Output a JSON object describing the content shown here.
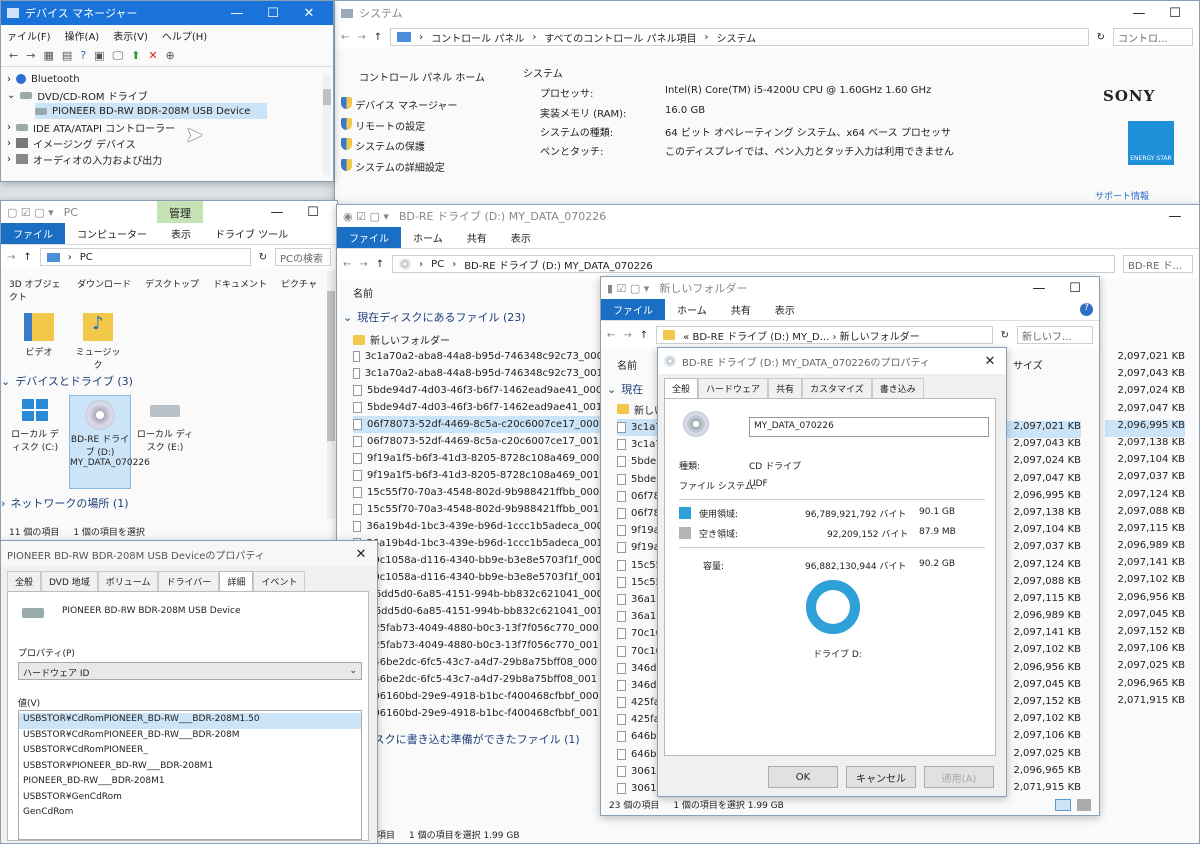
{
  "device_manager": {
    "title": "デバイス マネージャー",
    "menu": [
      "ァイル(F)",
      "操作(A)",
      "表示(V)",
      "ヘルプ(H)"
    ],
    "tree": [
      {
        "label": "Bluetooth",
        "level": 0
      },
      {
        "label": "DVD/CD-ROM ドライブ",
        "level": 0
      },
      {
        "label": "PIONEER BD-RW   BDR-208M USB Device",
        "level": 1
      },
      {
        "label": "IDE ATA/ATAPI コントローラー",
        "level": 0
      },
      {
        "label": "イメージング デバイス",
        "level": 0
      },
      {
        "label": "オーディオの入力および出力",
        "level": 0
      }
    ]
  },
  "system": {
    "title": "システム",
    "breadcrumb": [
      "コントロール パネル",
      "すべてのコントロール パネル項目",
      "システム"
    ],
    "search_placeholder": "コントロ...",
    "home_link": "コントロール パネル ホーム",
    "side_links": [
      "デバイス マネージャー",
      "リモートの設定",
      "システムの保護",
      "システムの詳細設定"
    ],
    "section": "システム",
    "rows": [
      {
        "label": "プロセッサ:",
        "value": "Intel(R) Core(TM) i5-4200U CPU @ 1.60GHz   1.60 GHz"
      },
      {
        "label": "実装メモリ (RAM):",
        "value": "16.0 GB"
      },
      {
        "label": "システムの種類:",
        "value": "64 ビット オペレーティング システム、x64 ベース プロセッサ"
      },
      {
        "label": "ペンとタッチ:",
        "value": "このディスプレイでは、ペン入力とタッチ入力は利用できません"
      }
    ],
    "brand": "SONY",
    "energy_star": "ENERGY STAR",
    "support": "サポート情報"
  },
  "pc_window": {
    "title": "PC",
    "manage_tab": "管理",
    "ribbon": [
      "ファイル",
      "コンピューター",
      "表示",
      "ドライブ ツール"
    ],
    "address": "PC",
    "search": "PCの検索",
    "quick": [
      "3D オブジェクト",
      "ダウンロード",
      "デスクトップ",
      "ドキュメント",
      "ピクチャ"
    ],
    "folders": [
      "ビデオ",
      "ミュージック"
    ],
    "devices_header": "デバイスとドライブ (3)",
    "drives": [
      "ローカル ディスク (C:)",
      "BD-RE ドライブ (D:) MY_DATA_070226",
      "ローカル ディスク (E:)"
    ],
    "network_header": "ネットワークの場所 (1)",
    "status": [
      "11 個の項目",
      "1 個の項目を選択"
    ]
  },
  "bdre_window": {
    "title": "BD-RE ドライブ (D:) MY_DATA_070226",
    "ribbon": [
      "ファイル",
      "ホーム",
      "共有",
      "表示"
    ],
    "address": [
      "PC",
      "BD-RE ドライブ (D:) MY_DATA_070226"
    ],
    "search": "BD-RE ド...",
    "col_name": "名前",
    "group_current": "現在ディスクにあるファイル (23)",
    "files": [
      "新しいフォルダー",
      "3c1a70a2-aba8-44a8-b95d-746348c92c73_000",
      "3c1a70a2-aba8-44a8-b95d-746348c92c73_001",
      "5bde94d7-4d03-46f3-b6f7-1462ead9ae41_000",
      "5bde94d7-4d03-46f3-b6f7-1462ead9ae41_001",
      "06f78073-52df-4469-8c5a-c20c6007ce17_000",
      "06f78073-52df-4469-8c5a-c20c6007ce17_001",
      "9f19a1f5-b6f3-41d3-8205-8728c108a469_000",
      "9f19a1f5-b6f3-41d3-8205-8728c108a469_001",
      "15c55f70-70a3-4548-802d-9b988421ffbb_000",
      "15c55f70-70a3-4548-802d-9b988421ffbb_001",
      "36a19b4d-1bc3-439e-b96d-1ccc1b5adeca_000",
      "36a19b4d-1bc3-439e-b96d-1ccc1b5adeca_001",
      "70c1058a-d116-4340-bb9e-b3e8e5703f1f_000",
      "70c1058a-d116-4340-bb9e-b3e8e5703f1f_001",
      "346dd5d0-6a85-4151-994b-bb832c621041_000",
      "346dd5d0-6a85-4151-994b-bb832c621041_001",
      "425fab73-4049-4880-b0c3-13f7f056c770_000",
      "425fab73-4049-4880-b0c3-13f7f056c770_001",
      "646be2dc-6fc5-43c7-a4d7-29b8a75bff08_000",
      "646be2dc-6fc5-43c7-a4d7-29b8a75bff08_001",
      "306160bd-29e9-4918-b1bc-f400468cfbbf_000",
      "306160bd-29e9-4918-b1bc-f400468cfbbf_001"
    ],
    "group_pending": "ディスクに書き込む準備ができたファイル (1)",
    "sizes_right": [
      "2,097,021 KB",
      "2,097,043 KB",
      "2,097,024 KB",
      "2,097,047 KB",
      "2,096,995 KB",
      "2,097,138 KB",
      "2,097,104 KB",
      "2,097,037 KB",
      "2,097,124 KB",
      "2,097,088 KB",
      "2,097,115 KB",
      "2,096,989 KB",
      "2,097,141 KB",
      "2,097,102 KB",
      "2,096,956 KB",
      "2,097,045 KB",
      "2,097,152 KB",
      "2,097,106 KB",
      "2,097,025 KB",
      "2,096,965 KB",
      "2,071,915 KB"
    ],
    "status": [
      "項目",
      "1 個の項目を選択  1.99 GB"
    ]
  },
  "new_folder_window": {
    "title": "新しいフォルダー",
    "ribbon": [
      "ファイル",
      "ホーム",
      "共有",
      "表示"
    ],
    "address": "« BD-RE ドライブ (D:) MY_D...  ›  新しいフォルダー",
    "search": "新しいフ...",
    "col_name": "名前",
    "col_size": "サイズ",
    "group_current": "現在",
    "first_item": "新しい",
    "items": [
      "3c1a7",
      "3c1a7",
      "5bde",
      "5bde",
      "06f78",
      "06f78",
      "9f19a",
      "9f19a",
      "15c55",
      "15c55",
      "36a19",
      "36a19",
      "70c10",
      "70c10",
      "346d",
      "346d",
      "425fa",
      "425fa",
      "646b",
      "646b",
      "30610",
      "30610"
    ],
    "sizes": [
      "2,097,021 KB",
      "2,097,043 KB",
      "2,097,024 KB",
      "2,097,047 KB",
      "2,096,995 KB",
      "2,097,138 KB",
      "2,097,104 KB",
      "2,097,037 KB",
      "2,097,124 KB",
      "2,097,088 KB",
      "2,097,115 KB",
      "2,096,989 KB",
      "2,097,141 KB",
      "2,097,102 KB",
      "2,096,956 KB",
      "2,097,045 KB",
      "2,097,152 KB",
      "2,097,102 KB",
      "2,097,106 KB",
      "2,097,025 KB",
      "2,096,965 KB",
      "2,071,915 KB"
    ],
    "status": [
      "23 個の項目",
      "1 個の項目を選択  1.99 GB"
    ]
  },
  "drive_props": {
    "title": "BD-RE ドライブ (D:) MY_DATA_070226のプロパティ",
    "tabs": [
      "全般",
      "ハードウェア",
      "共有",
      "カスタマイズ",
      "書き込み"
    ],
    "label_value": "MY_DATA_070226",
    "type_label": "種類:",
    "type_value": "CD ドライブ",
    "fs_label": "ファイル システム:",
    "fs_value": "UDF",
    "used_label": "使用領域:",
    "used_bytes": "96,789,921,792 バイト",
    "used_h": "90.1 GB",
    "free_label": "空き領域:",
    "free_bytes": "92,209,152 バイト",
    "free_h": "87.9 MB",
    "cap_label": "容量:",
    "cap_bytes": "96,882,130,944 バイト",
    "cap_h": "90.2 GB",
    "used_fraction": 0.999,
    "drive_label": "ドライブ D:",
    "buttons": [
      "OK",
      "キャンセル",
      "適用(A)"
    ],
    "used_color": "#2ea1d9",
    "free_color": "#b4b4b4"
  },
  "device_props": {
    "title": "PIONEER BD-RW   BDR-208M USB Deviceのプロパティ",
    "tabs": [
      "全般",
      "DVD 地域",
      "ボリューム",
      "ドライバー",
      "詳細",
      "イベント"
    ],
    "device_name": "PIONEER BD-RW   BDR-208M USB Device",
    "property_label": "プロパティ(P)",
    "property_value": "ハードウェア ID",
    "value_label": "値(V)",
    "values": [
      "USBSTOR¥CdRomPIONEER_BD-RW___BDR-208M1.50",
      "USBSTOR¥CdRomPIONEER_BD-RW___BDR-208M",
      "USBSTOR¥CdRomPIONEER_",
      "USBSTOR¥PIONEER_BD-RW___BDR-208M1",
      "PIONEER_BD-RW___BDR-208M1",
      "USBSTOR¥GenCdRom",
      "GenCdRom"
    ]
  }
}
